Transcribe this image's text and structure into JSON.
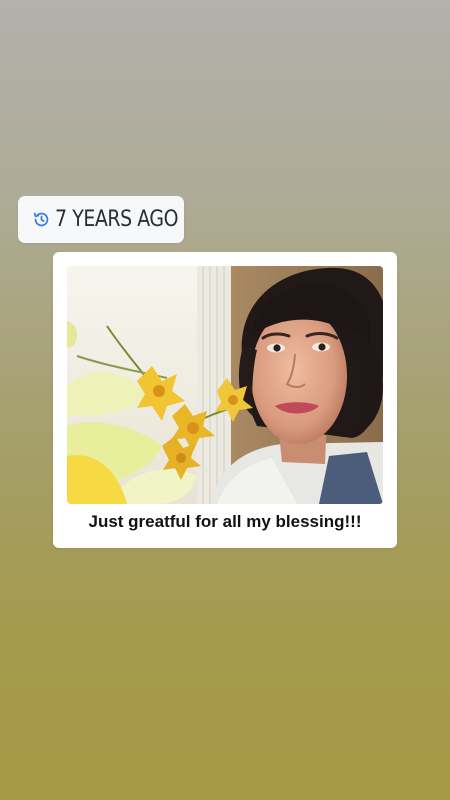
{
  "memory_badge": {
    "icon": "history-icon",
    "label": "7 YEARS AGO",
    "icon_color": "#3b7bdc"
  },
  "memory_card": {
    "photo_icon": "selfie-photo",
    "caption": "Just greatful for all my blessing!!!"
  },
  "colors": {
    "background_top": "#b2b1ab",
    "background_bottom": "#a79a45",
    "card": "#ffffff",
    "caption_text": "#121212"
  }
}
